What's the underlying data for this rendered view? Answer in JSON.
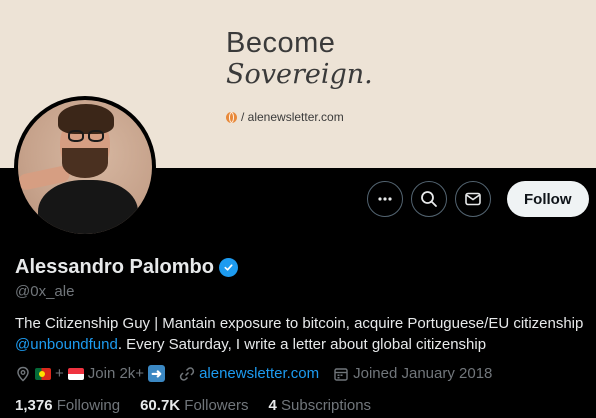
{
  "banner": {
    "line1": "Become",
    "line2": "Sovereign.",
    "url": "/ alenewsletter.com",
    "accent": "#e8893a"
  },
  "profile": {
    "name": "Alessandro Palombo",
    "handle": "@0x_ale",
    "verified": true,
    "bio_part1": "The Citizenship Guy | Mantain exposure to bitcoin, acquire Portuguese/EU citizenship ",
    "bio_mention": "@unboundfund",
    "bio_part2": ". Every Saturday, I write a letter about global citizenship"
  },
  "actions": {
    "more_icon": "more-icon",
    "search_icon": "search-icon",
    "message_icon": "mail-icon",
    "follow_label": "Follow"
  },
  "meta": {
    "location_plus": "+",
    "location_text": "Join 2k+",
    "website": "alenewsletter.com",
    "joined": "Joined January 2018"
  },
  "stats": {
    "following_count": "1,376",
    "following_label": "Following",
    "followers_count": "60.7K",
    "followers_label": "Followers",
    "subscriptions_count": "4",
    "subscriptions_label": "Subscriptions"
  },
  "colors": {
    "accent": "#1d9bf0",
    "muted": "#71767b",
    "text": "#e7e9ea",
    "banner_bg": "#ede3d6"
  }
}
